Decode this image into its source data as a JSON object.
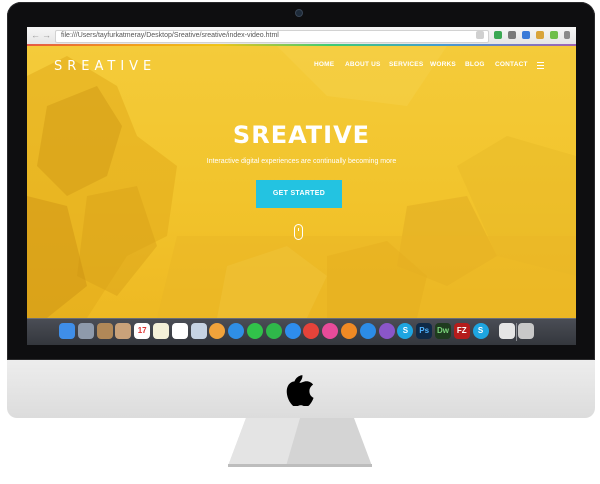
{
  "browser": {
    "url": "file:///Users/tayfurkatmeray/Desktop/Sreative/sreative/index-video.html",
    "back_glyph": "←",
    "forward_glyph": "→"
  },
  "site": {
    "logo": "SREATIVE",
    "nav": [
      "HOME",
      "ABOUT US",
      "SERVICES",
      "WORKS",
      "BLOG",
      "CONTACT"
    ],
    "hero_title": "SREATIVE",
    "hero_subtitle": "Interactive digital experiences are continually becoming more",
    "cta_label": "GET STARTED"
  },
  "colors": {
    "hero_yellow": "#f2c42c",
    "cta_cyan": "#23c3e1",
    "bezel": "#0e0e10",
    "chin": "#e6e6e6"
  },
  "dock": {
    "apps": [
      {
        "name": "finder-icon",
        "color": "#3f8ee8",
        "label": ""
      },
      {
        "name": "launchpad-icon",
        "color": "#8e9aab",
        "label": ""
      },
      {
        "name": "photos-folder-icon",
        "color": "#b08858",
        "label": ""
      },
      {
        "name": "contacts-icon",
        "color": "#c9a27a",
        "label": ""
      },
      {
        "name": "calendar-icon",
        "color": "#ffffff",
        "label": "17"
      },
      {
        "name": "notes-icon",
        "color": "#f4f0d8",
        "label": ""
      },
      {
        "name": "reminders-icon",
        "color": "#ffffff",
        "label": ""
      },
      {
        "name": "preview-icon",
        "color": "#c6d3e3",
        "label": ""
      },
      {
        "name": "photos-icon",
        "color": "#f1a33b",
        "label": ""
      },
      {
        "name": "mail-icon",
        "color": "#2f8fe6",
        "label": ""
      },
      {
        "name": "messages-icon",
        "color": "#31c24a",
        "label": ""
      },
      {
        "name": "facetime-icon",
        "color": "#2fb84a",
        "label": ""
      },
      {
        "name": "safari-icon",
        "color": "#2e8ded",
        "label": ""
      },
      {
        "name": "chrome-icon",
        "color": "#e5433a",
        "label": ""
      },
      {
        "name": "itunes-icon",
        "color": "#e74b9a",
        "label": ""
      },
      {
        "name": "ibooks-icon",
        "color": "#f08a24",
        "label": ""
      },
      {
        "name": "app-store-icon",
        "color": "#2c8ce6",
        "label": ""
      },
      {
        "name": "utility-icon",
        "color": "#8a56c9",
        "label": ""
      },
      {
        "name": "skype-icon",
        "color": "#1ea5e0",
        "label": "S"
      },
      {
        "name": "photoshop-icon",
        "color": "#0f2a47",
        "label": "Ps"
      },
      {
        "name": "dreamweaver-icon",
        "color": "#1f3b1f",
        "label": "Dw"
      },
      {
        "name": "filezilla-icon",
        "color": "#b51c1c",
        "label": "FZ"
      },
      {
        "name": "skype-icon-2",
        "color": "#1ea5e0",
        "label": "S"
      },
      {
        "name": "documents-icon",
        "color": "#e5e5e5",
        "label": ""
      },
      {
        "name": "trash-icon",
        "color": "#c8c8c8",
        "label": ""
      }
    ]
  }
}
